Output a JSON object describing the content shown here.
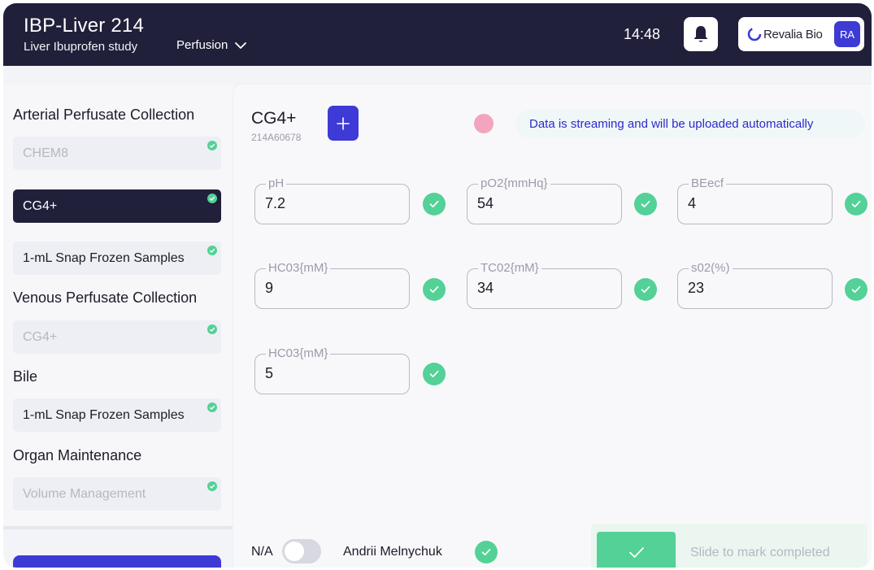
{
  "header": {
    "title": "IBP-Liver 214",
    "study": "Liver Ibuprofen study",
    "phase": "Perfusion",
    "time": "14:48",
    "brand": "Revalia Bio",
    "avatar_initials": "RA"
  },
  "sidebar": {
    "sections": [
      {
        "title": "Arterial Perfusate Collection"
      },
      {
        "title": "Venous Perfusate Collection"
      },
      {
        "title": "Bile"
      },
      {
        "title": "Organ Maintenance"
      }
    ],
    "items": [
      {
        "label": "CHEM8",
        "state": "muted"
      },
      {
        "label": "CG4+",
        "state": "active"
      },
      {
        "label": "1-mL Snap Frozen Samples",
        "state": "normal"
      },
      {
        "label": "CG4+",
        "state": "muted"
      },
      {
        "label": "1-mL Snap Frozen Samples",
        "state": "normal"
      },
      {
        "label": "Volume Management",
        "state": "muted"
      }
    ]
  },
  "panel": {
    "device_name": "CG4+",
    "device_id": "214A60678",
    "stream_status": "Data is streaming and will be uploaded automatically",
    "fields": [
      {
        "label": "pH",
        "value": "7.2"
      },
      {
        "label": "pO2{mmHq}",
        "value": "54"
      },
      {
        "label": "BEecf",
        "value": "4"
      },
      {
        "label": "HC03{mM}",
        "value": "9"
      },
      {
        "label": "TC02{mM}",
        "value": "34"
      },
      {
        "label": "s02(%)",
        "value": "23"
      },
      {
        "label": "HC03{mM}",
        "value": "5"
      }
    ],
    "na_label": "N/A",
    "na_toggle_on": false,
    "user_name": "Andrii Melnychuk",
    "slide_label": "Slide to mark completed"
  },
  "colors": {
    "header_bg": "#21203b",
    "accent": "#3d3ad6",
    "success": "#53d196",
    "status_dot": "#f2a5bc"
  },
  "icons": {
    "phase_menu": "chevron-down-icon",
    "notifications": "bell-icon",
    "add": "plus-icon",
    "field_status": "check-icon",
    "slider": "check-icon"
  }
}
